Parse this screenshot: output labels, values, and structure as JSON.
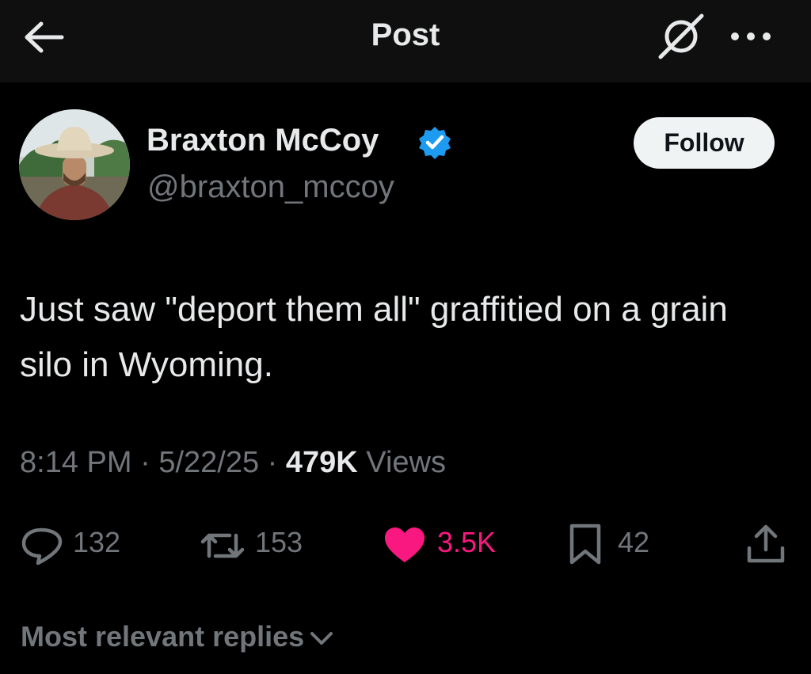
{
  "header": {
    "title": "Post",
    "icons": {
      "back": "arrow-left-icon",
      "grok": "grok-icon",
      "more": "more-horizontal-icon"
    }
  },
  "author": {
    "display_name": "Braxton McCoy",
    "handle": "@braxton_mccoy",
    "verified": true,
    "follow_label": "Follow"
  },
  "post": {
    "text": "Just saw \"deport them all\" graffitied on a grain silo in Wyoming.",
    "time": "8:14 PM",
    "separator": "·",
    "date": "5/22/25",
    "views_count": "479K",
    "views_label": "Views"
  },
  "actions": {
    "replies": "132",
    "reposts": "153",
    "likes": "3.5K",
    "bookmarks": "42"
  },
  "replies_sort": {
    "label": "Most relevant replies"
  },
  "colors": {
    "background": "#000000",
    "header_background": "#0f0f0f",
    "primary_text": "#e7e9ea",
    "secondary_text": "#71767b",
    "verified_blue": "#1d9bf0",
    "like_pink": "#f91880",
    "follow_button": "#eff3f4"
  }
}
